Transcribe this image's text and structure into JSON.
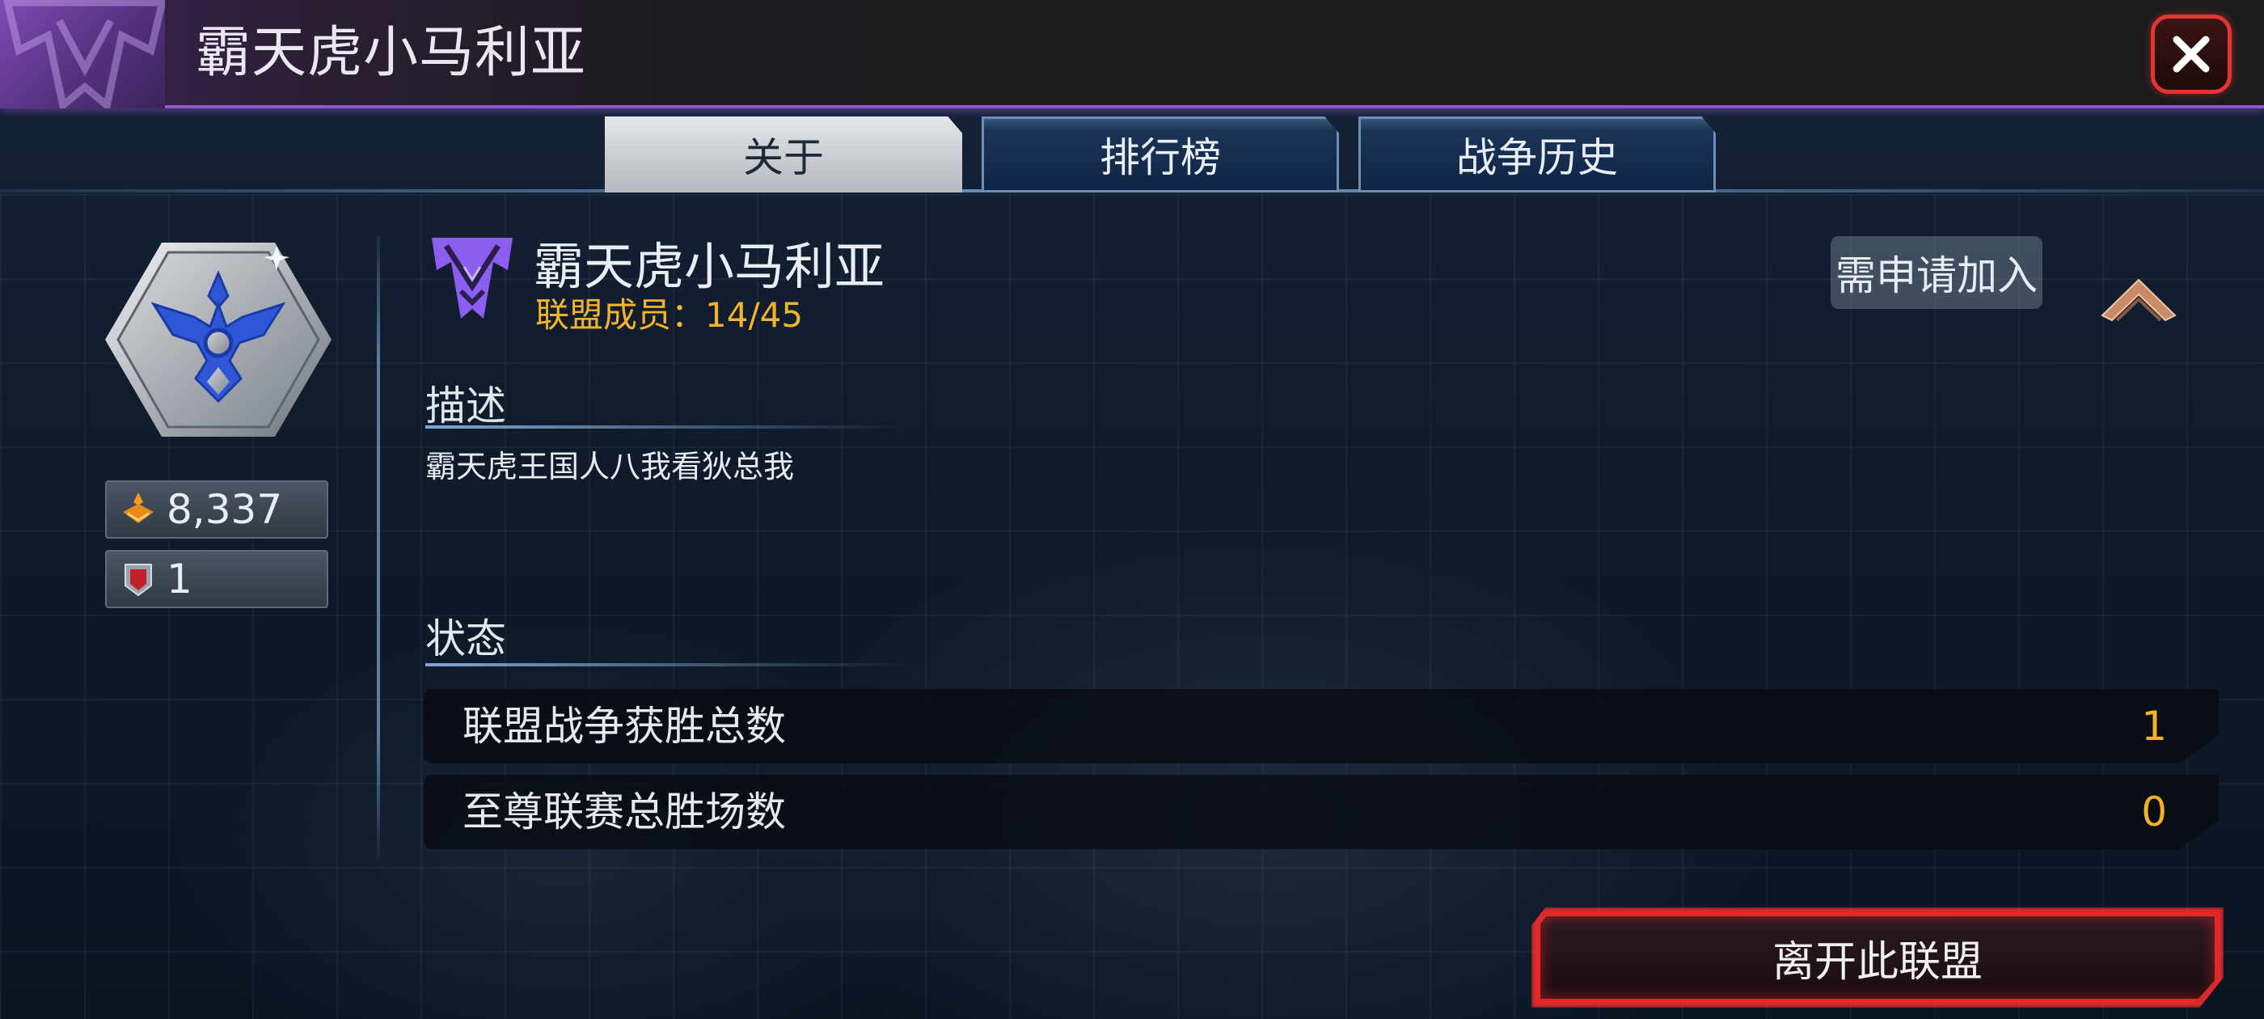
{
  "window": {
    "title": "霸天虎小马利亚",
    "close_icon": "close-icon"
  },
  "tabs": [
    {
      "label": "关于",
      "active": true
    },
    {
      "label": "排行榜",
      "active": false
    },
    {
      "label": "战争历史",
      "active": false
    }
  ],
  "emblem": {
    "icon": "alliance-emblem-icon"
  },
  "stats": {
    "power": {
      "icon": "power-icon",
      "value": "8,337"
    },
    "rank": {
      "icon": "rank-badge-icon",
      "value": "1"
    }
  },
  "alliance": {
    "faction_icon": "decepticon-icon",
    "name": "霸天虎小马利亚",
    "members_text": "联盟成员：14/45",
    "join_requirement": "需申请加入",
    "rank_icon": "rank-chevron-icon"
  },
  "description": {
    "title": "描述",
    "text": "霸天虎王国人八我看狄总我"
  },
  "status": {
    "title": "状态",
    "rows": [
      {
        "label": "联盟战争获胜总数",
        "value": "1"
      },
      {
        "label": "至尊联赛总胜场数",
        "value": "0"
      }
    ]
  },
  "actions": {
    "leave_label": "离开此联盟"
  },
  "colors": {
    "accent_gold": "#f1b42b",
    "faction_purple": "#8e56c8",
    "danger_red": "#e32828"
  }
}
